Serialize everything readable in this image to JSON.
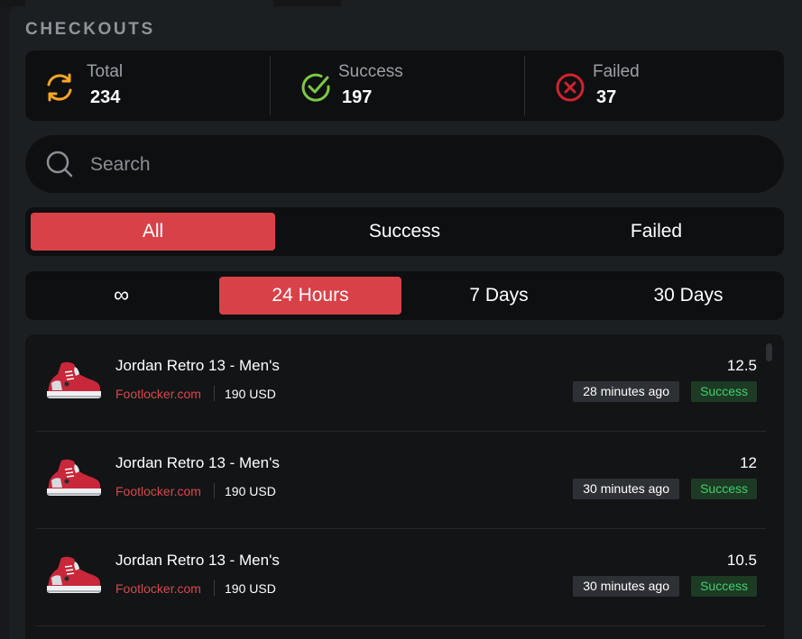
{
  "heading": "CHECKOUTS",
  "stats": [
    {
      "label": "Total",
      "value": "234",
      "icon": "sync-icon",
      "color": "#f5a623"
    },
    {
      "label": "Success",
      "value": "197",
      "icon": "check-circle-icon",
      "color": "#7ac943"
    },
    {
      "label": "Failed",
      "value": "37",
      "icon": "x-circle-icon",
      "color": "#d0232f"
    }
  ],
  "search": {
    "placeholder": "Search"
  },
  "status_filter": {
    "options": [
      "All",
      "Success",
      "Failed"
    ],
    "selected": "All"
  },
  "time_filter": {
    "options": [
      "∞",
      "24 Hours",
      "7 Days",
      "30 Days"
    ],
    "selected": "24 Hours"
  },
  "colors": {
    "accent": "#d94148",
    "success": "#3fd16a",
    "store": "#d9474e"
  },
  "checkouts": [
    {
      "name": "Jordan Retro 13 - Men's",
      "store": "Footlocker.com",
      "price": "190 USD",
      "size": "12.5",
      "time": "28 minutes ago",
      "status": "Success"
    },
    {
      "name": "Jordan Retro 13 - Men's",
      "store": "Footlocker.com",
      "price": "190 USD",
      "size": "12",
      "time": "30 minutes ago",
      "status": "Success"
    },
    {
      "name": "Jordan Retro 13 - Men's",
      "store": "Footlocker.com",
      "price": "190 USD",
      "size": "10.5",
      "time": "30 minutes ago",
      "status": "Success"
    }
  ]
}
